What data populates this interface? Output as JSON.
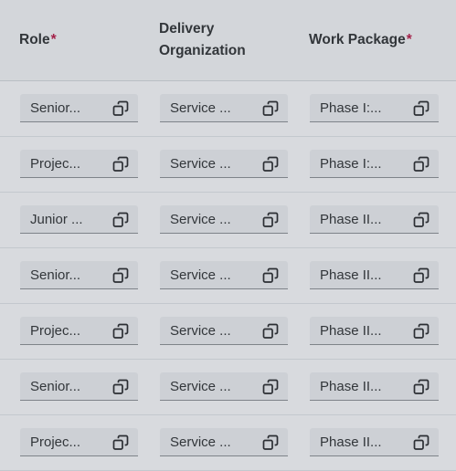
{
  "header": {
    "role": "Role",
    "delivery_line1": "Delivery",
    "delivery_line2": "Organization",
    "work_package": "Work Package",
    "required_mark": "*"
  },
  "rows": [
    {
      "role": "Senior...",
      "delivery": "Service ...",
      "work_package": "Phase I:..."
    },
    {
      "role": "Projec...",
      "delivery": "Service ...",
      "work_package": "Phase I:..."
    },
    {
      "role": "Junior ...",
      "delivery": "Service ...",
      "work_package": "Phase II..."
    },
    {
      "role": "Senior...",
      "delivery": "Service ...",
      "work_package": "Phase II..."
    },
    {
      "role": "Projec...",
      "delivery": "Service ...",
      "work_package": "Phase II..."
    },
    {
      "role": "Senior...",
      "delivery": "Service ...",
      "work_package": "Phase II..."
    },
    {
      "role": "Projec...",
      "delivery": "Service ...",
      "work_package": "Phase II..."
    }
  ],
  "icons": {
    "value_help": "value-help-icon"
  },
  "colors": {
    "background": "#d8dade",
    "header_background": "#d3d6da",
    "field_background": "#cdd0d5",
    "required": "#a4224a",
    "text": "#32363a"
  }
}
